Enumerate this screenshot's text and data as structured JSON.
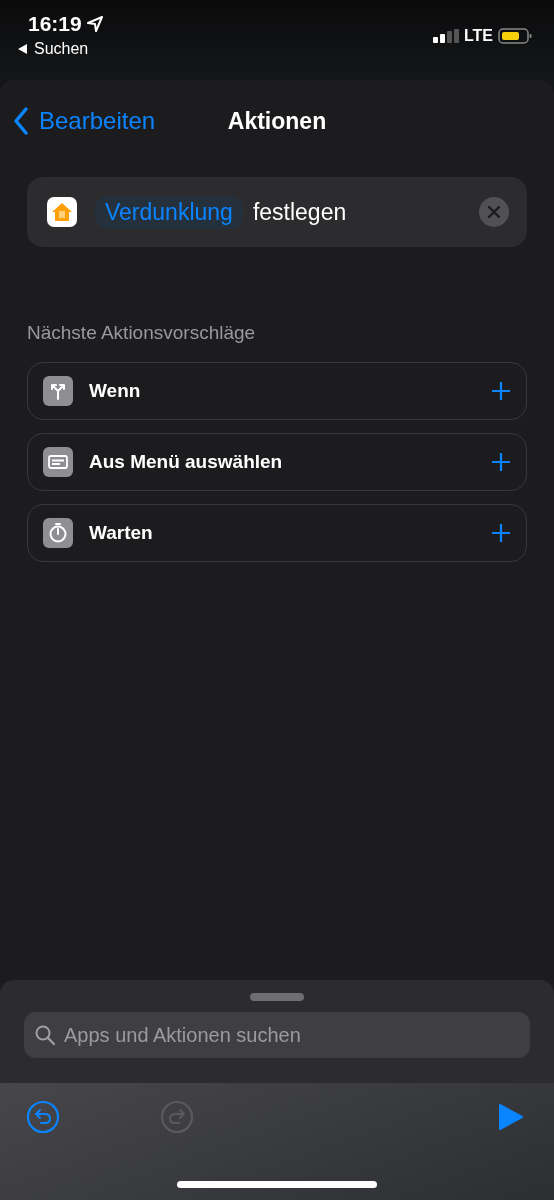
{
  "status_bar": {
    "time": "16:19",
    "back_app": "Suchen",
    "network": "LTE"
  },
  "nav": {
    "back": "Bearbeiten",
    "title": "Aktionen"
  },
  "action": {
    "variable": "Verdunklung",
    "verb": "festlegen"
  },
  "suggestions": {
    "heading": "Nächste Aktionsvorschläge",
    "items": [
      {
        "kind": "branch",
        "label": "Wenn"
      },
      {
        "kind": "menu",
        "label": "Aus Menü auswählen"
      },
      {
        "kind": "timer",
        "label": "Warten"
      }
    ]
  },
  "search": {
    "placeholder": "Apps und Aktionen suchen"
  },
  "toolbar": {
    "undo_disabled": false,
    "redo_disabled": true
  }
}
